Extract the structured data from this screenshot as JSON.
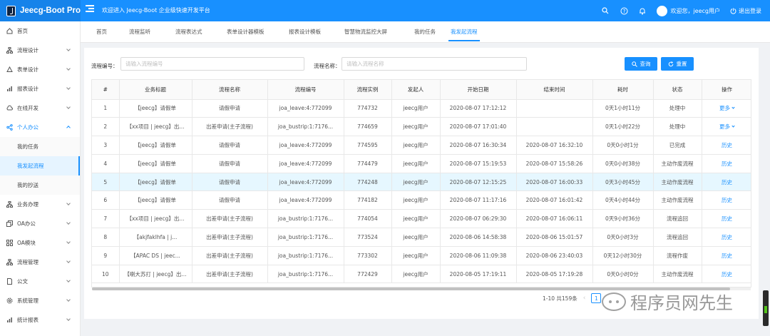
{
  "app": {
    "name": "Jeecg-Boot Pro",
    "welcome": "欢迎进入 Jeecg-Boot 企业级快速开发平台"
  },
  "header": {
    "user_label": "欢迎您，jeecg用户",
    "logout_label": "退出登录"
  },
  "sidebar": {
    "items": [
      {
        "label": "首页",
        "icon": "home-icon"
      },
      {
        "label": "流程设计",
        "icon": "flow-icon"
      },
      {
        "label": "表单设计",
        "icon": "form-icon"
      },
      {
        "label": "报表设计",
        "icon": "chart-icon"
      },
      {
        "label": "在线开发",
        "icon": "cloud-icon"
      },
      {
        "label": "个人办公",
        "icon": "share-icon"
      },
      {
        "label": "我的任务",
        "icon": ""
      },
      {
        "label": "我发起流程",
        "icon": ""
      },
      {
        "label": "我的抄送",
        "icon": ""
      },
      {
        "label": "业务办理",
        "icon": "flow-icon"
      },
      {
        "label": "OA办公",
        "icon": "copy-icon"
      },
      {
        "label": "OA模块",
        "icon": "grid-icon"
      },
      {
        "label": "流程管理",
        "icon": "flow-icon"
      },
      {
        "label": "公文",
        "icon": "doc-icon"
      },
      {
        "label": "系统管理",
        "icon": "gear-icon"
      },
      {
        "label": "统计报表",
        "icon": "chart-icon"
      }
    ]
  },
  "tabs": [
    "首页",
    "流程监听",
    "流程表达式",
    "表单设计器模板",
    "报表设计模板",
    "智慧物流监控大屏",
    "我的任务",
    "我发起流程"
  ],
  "filters": {
    "code_label": "流程编号：",
    "code_placeholder": "请输入流程编号",
    "name_label": "流程名称：",
    "name_placeholder": "请输入流程名称",
    "search_label": "查询",
    "reset_label": "重置"
  },
  "table": {
    "columns": [
      "#",
      "业务标题",
      "流程名称",
      "流程编号",
      "流程实例",
      "发起人",
      "开始日期",
      "结束时间",
      "耗时",
      "状态",
      "操作"
    ],
    "rows": [
      [
        "1",
        "【jeecg】请假单",
        "请假申请",
        "joa_leave:4:772099",
        "774732",
        "jeecg用户",
        "2020-08-07 17:12:12",
        "",
        "0天1小时11分",
        "处理中",
        "更多"
      ],
      [
        "2",
        "【xx项目 | jeecg】出...",
        "出差申请(主子流程)",
        "joa_bustrip:1:7176...",
        "774659",
        "jeecg用户",
        "2020-08-07 17:01:40",
        "",
        "0天1小时22分",
        "处理中",
        "更多"
      ],
      [
        "3",
        "【jeecg】请假单",
        "请假申请",
        "joa_leave:4:772099",
        "774595",
        "jeecg用户",
        "2020-08-07 16:30:34",
        "2020-08-07 16:32:10",
        "0天0小时1分",
        "已完成",
        "历史"
      ],
      [
        "4",
        "【jeecg】请假单",
        "请假申请",
        "joa_leave:4:772099",
        "774479",
        "jeecg用户",
        "2020-08-07 15:19:53",
        "2020-08-07 15:58:26",
        "0天0小时38分",
        "主动作废流程",
        "历史"
      ],
      [
        "5",
        "【jeecg】请假单",
        "请假申请",
        "joa_leave:4:772099",
        "774248",
        "jeecg用户",
        "2020-08-07 12:15:25",
        "2020-08-07 16:00:33",
        "0天3小时45分",
        "主动作废流程",
        "历史"
      ],
      [
        "6",
        "【jeecg】请假单",
        "请假申请",
        "joa_leave:4:772099",
        "774182",
        "jeecg用户",
        "2020-08-07 11:17:16",
        "2020-08-07 16:01:42",
        "0天4小时44分",
        "主动作废流程",
        "历史"
      ],
      [
        "7",
        "【xx项目 | jeecg】出...",
        "出差申请(主子流程)",
        "joa_bustrip:1:7176...",
        "774054",
        "jeecg用户",
        "2020-08-07 06:29:30",
        "2020-08-07 16:06:11",
        "0天9小时36分",
        "流程追回",
        "历史"
      ],
      [
        "8",
        "【akjfaklhfa | j...",
        "出差申请(主子流程)",
        "joa_bustrip:1:7176...",
        "773524",
        "jeecg用户",
        "2020-08-06 14:58:38",
        "2020-08-06 15:01:57",
        "0天0小时3分",
        "流程追回",
        "历史"
      ],
      [
        "9",
        "【APAC DS | jeec...",
        "出差申请(主子流程)",
        "joa_bustrip:1:7176...",
        "773302",
        "jeecg用户",
        "2020-08-06 11:09:38",
        "2020-08-06 23:40:03",
        "0天12小时30分",
        "流程作废",
        "历史"
      ],
      [
        "10",
        "【喇大苏打 | jeecg】出...",
        "出差申请(主子流程)",
        "joa_bustrip:1:7176...",
        "772429",
        "jeecg用户",
        "2020-08-05 17:19:11",
        "2020-08-05 17:19:28",
        "0天0小时0分",
        "主动作废流程",
        "历史"
      ]
    ]
  },
  "pagination": {
    "summary": "1-10 共159条",
    "current_page": "1"
  },
  "watermark": "程序员网先生"
}
